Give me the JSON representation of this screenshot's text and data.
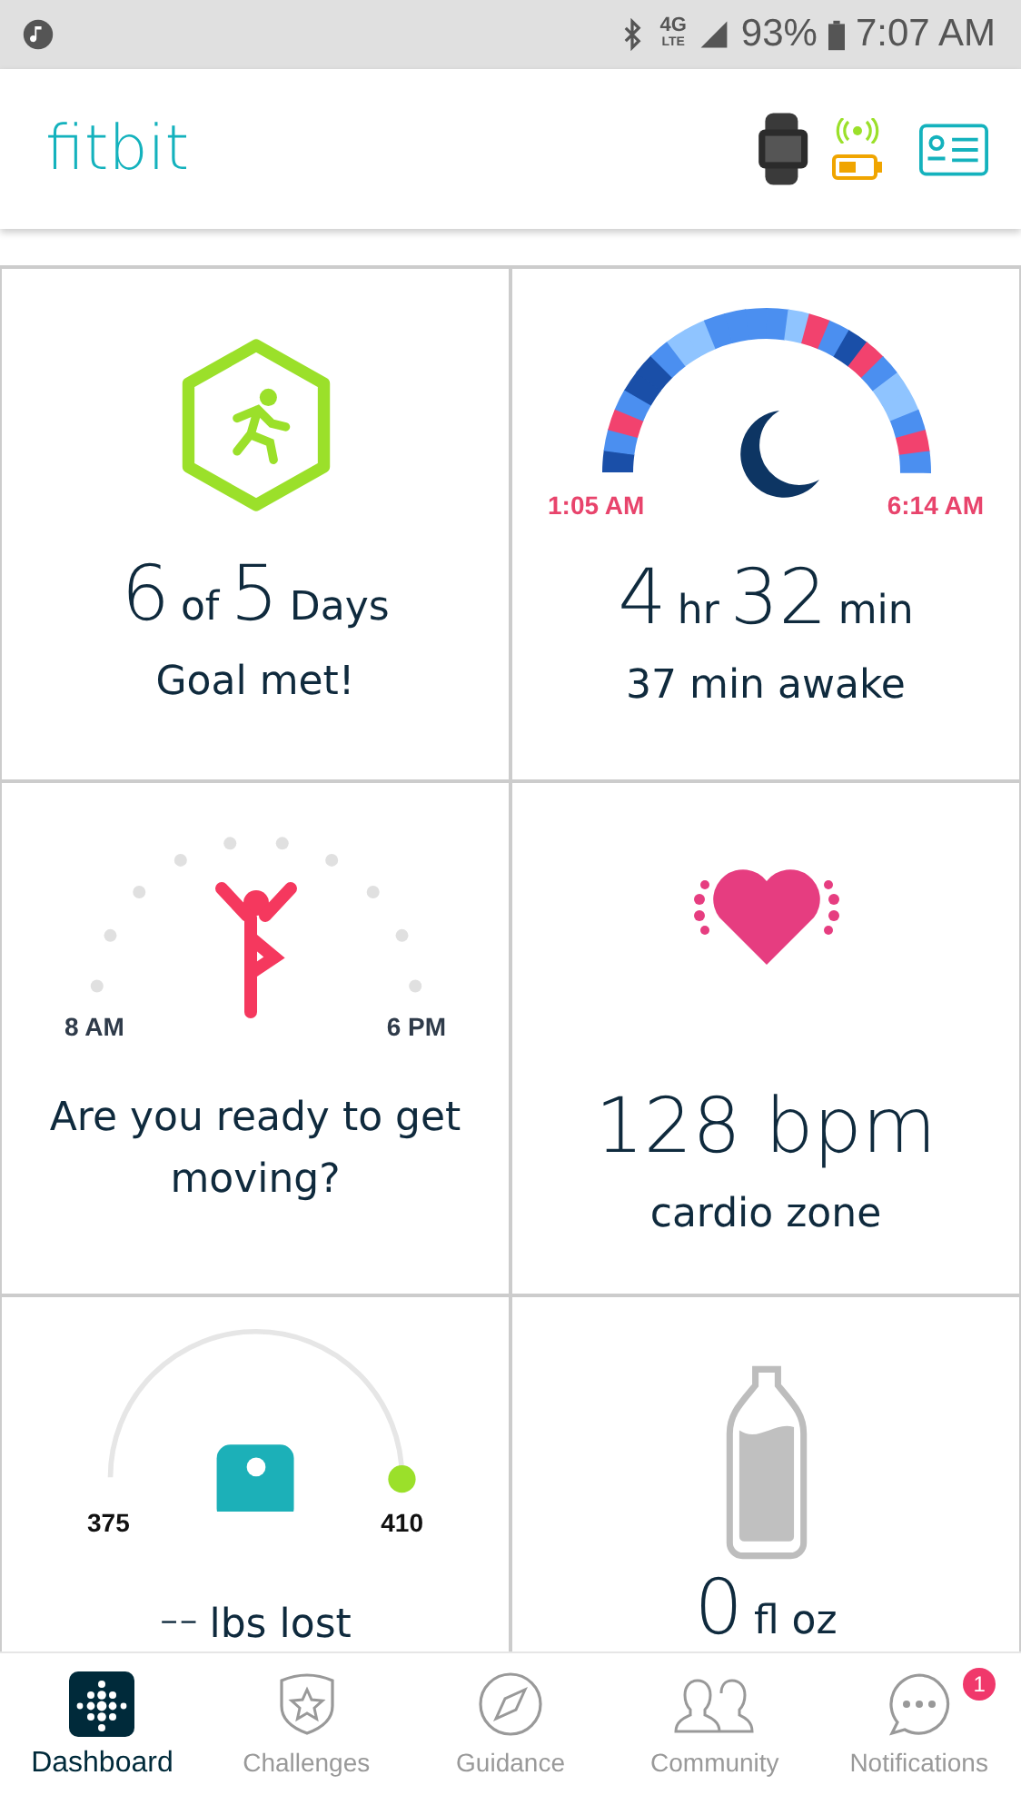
{
  "status_bar": {
    "network": "4G",
    "network_sub": "LTE",
    "battery": "93%",
    "time": "7:07 AM"
  },
  "header": {
    "logo": "fitbit"
  },
  "tiles": [
    {
      "kind": "exercise",
      "value_parts": [
        {
          "text": "6",
          "kind": "number"
        },
        {
          "text": "of",
          "kind": "unit"
        },
        {
          "text": "5",
          "kind": "number"
        },
        {
          "text": "Days",
          "kind": "unit"
        }
      ],
      "caption": "Goal met!"
    },
    {
      "kind": "sleep",
      "start": "1:05 AM",
      "end": "6:14 AM",
      "value_parts": [
        {
          "text": "4",
          "kind": "number"
        },
        {
          "text": "hr",
          "kind": "unit"
        },
        {
          "text": "32",
          "kind": "number"
        },
        {
          "text": "min",
          "kind": "unit"
        }
      ],
      "caption": "37 min awake"
    },
    {
      "kind": "hourly",
      "start": "8 AM",
      "end": "6 PM",
      "caption": "Are you ready to get moving?"
    },
    {
      "kind": "heart",
      "value_parts": [
        {
          "text": "128 bpm",
          "kind": "number"
        }
      ],
      "caption": "cardio zone"
    },
    {
      "kind": "weight",
      "start": "375",
      "end": "410",
      "value_parts": [
        {
          "text": "--",
          "kind": "number"
        },
        {
          "text": "lbs lost",
          "kind": "unit"
        }
      ]
    },
    {
      "kind": "water",
      "value_parts": [
        {
          "text": "0",
          "kind": "number"
        },
        {
          "text": "fl oz",
          "kind": "unit"
        }
      ]
    }
  ],
  "nav": [
    {
      "label": "Dashboard",
      "kind": "dashboard",
      "selected": true
    },
    {
      "label": "Challenges",
      "kind": "challenges",
      "selected": false
    },
    {
      "label": "Guidance",
      "kind": "guidance",
      "selected": false
    },
    {
      "label": "Community",
      "kind": "community",
      "selected": false
    },
    {
      "label": "Notifications",
      "kind": "notifications",
      "selected": false,
      "badge": "1"
    }
  ]
}
